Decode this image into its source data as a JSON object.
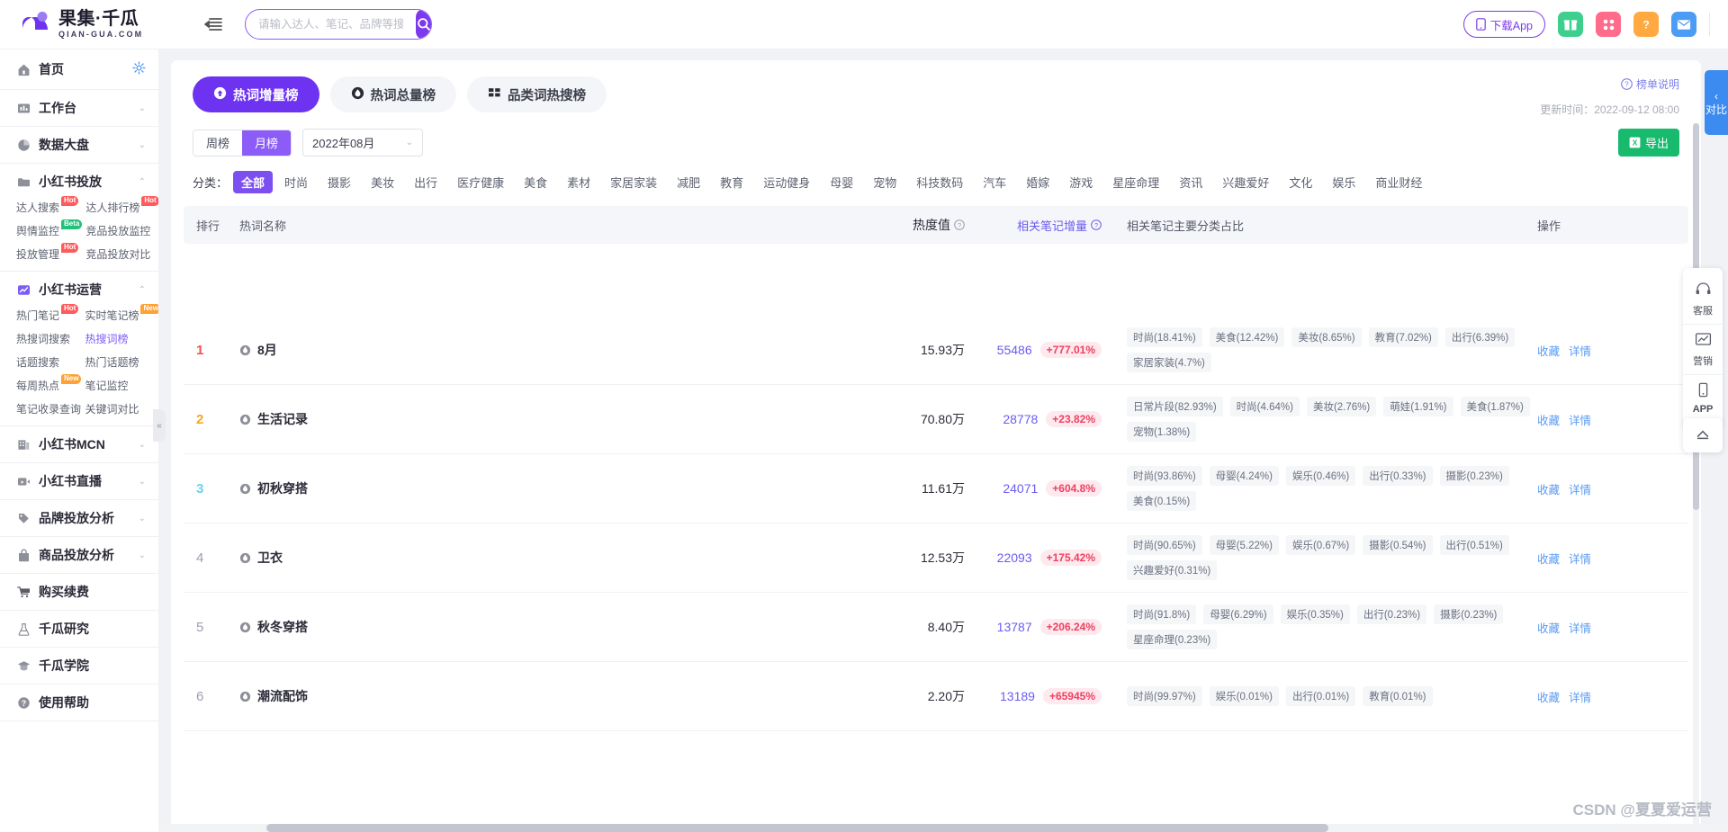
{
  "brand": {
    "name_cn": "果集·千瓜",
    "name_en": "QIAN-GUA.COM"
  },
  "search": {
    "placeholder": "请输入达人、笔记、品牌等搜索",
    "value": ""
  },
  "topbar": {
    "download_label": "下载App",
    "icons": [
      "collapse-icon",
      "search-icon",
      "gift-icon",
      "apps-icon",
      "help-icon",
      "mail-icon"
    ]
  },
  "sidebar": {
    "groups": [
      {
        "label": "首页",
        "icon": "home-icon",
        "caret": "",
        "gear": true,
        "subs": []
      },
      {
        "label": "工作台",
        "icon": "workbench-icon",
        "caret": "⌄",
        "subs": []
      },
      {
        "label": "数据大盘",
        "icon": "pie-chart-icon",
        "caret": "⌄",
        "subs": []
      },
      {
        "label": "小红书投放",
        "icon": "folder-icon",
        "caret": "⌃",
        "subs": [
          {
            "label": "达人搜索",
            "tag": "Hot",
            "tag_type": "hot"
          },
          {
            "label": "达人排行榜",
            "tag": "Hot",
            "tag_type": "hot"
          },
          {
            "label": "舆情监控",
            "tag": "Beta",
            "tag_type": "beta"
          },
          {
            "label": "竞品投放监控",
            "tag": "",
            "tag_type": ""
          },
          {
            "label": "投放管理",
            "tag": "Hot",
            "tag_type": "hot"
          },
          {
            "label": "竞品投放对比",
            "tag": "",
            "tag_type": ""
          }
        ]
      },
      {
        "label": "小红书运营",
        "icon": "chart-line-icon",
        "caret": "⌃",
        "subs": [
          {
            "label": "热门笔记",
            "tag": "Hot",
            "tag_type": "hot"
          },
          {
            "label": "实时笔记榜",
            "tag": "New",
            "tag_type": "new"
          },
          {
            "label": "热搜词搜索",
            "tag": "",
            "tag_type": ""
          },
          {
            "label": "热搜词榜",
            "tag": "",
            "tag_type": "",
            "active": true
          },
          {
            "label": "话题搜索",
            "tag": "",
            "tag_type": ""
          },
          {
            "label": "热门话题榜",
            "tag": "",
            "tag_type": ""
          },
          {
            "label": "每周热点",
            "tag": "New",
            "tag_type": "new"
          },
          {
            "label": "笔记监控",
            "tag": "",
            "tag_type": ""
          },
          {
            "label": "笔记收录查询",
            "tag": "",
            "tag_type": ""
          },
          {
            "label": "关键词对比",
            "tag": "",
            "tag_type": ""
          }
        ]
      },
      {
        "label": "小红书MCN",
        "icon": "building-icon",
        "caret": "⌄",
        "subs": []
      },
      {
        "label": "小红书直播",
        "icon": "video-icon",
        "caret": "⌄",
        "subs": []
      },
      {
        "label": "品牌投放分析",
        "icon": "tag-icon",
        "caret": "⌄",
        "subs": []
      },
      {
        "label": "商品投放分析",
        "icon": "bag-icon",
        "caret": "⌄",
        "subs": []
      },
      {
        "label": "购买续费",
        "icon": "cart-icon",
        "caret": "",
        "subs": []
      },
      {
        "label": "千瓜研究",
        "icon": "flask-icon",
        "caret": "",
        "subs": []
      },
      {
        "label": "千瓜学院",
        "icon": "graduation-icon",
        "caret": "",
        "subs": []
      },
      {
        "label": "使用帮助",
        "icon": "question-icon",
        "caret": "",
        "subs": []
      }
    ]
  },
  "tabs": [
    {
      "label": "热词增量榜",
      "icon": "arrow-up-circle-icon",
      "active": true
    },
    {
      "label": "热词总量榜",
      "icon": "droplet-circle-icon",
      "active": false
    },
    {
      "label": "品类词热搜榜",
      "icon": "grid-icon",
      "active": false
    }
  ],
  "header_info": {
    "rank_help": "榜单说明",
    "update_time": "更新时间：2022-09-12 08:00"
  },
  "filters": {
    "period": {
      "options": [
        "周榜",
        "月榜"
      ],
      "selected": "月榜"
    },
    "month": {
      "value": "2022年08月"
    },
    "export_label": "导出"
  },
  "categories": {
    "label": "分类：",
    "items": [
      "全部",
      "时尚",
      "摄影",
      "美妆",
      "出行",
      "医疗健康",
      "美食",
      "素材",
      "家居家装",
      "减肥",
      "教育",
      "运动健身",
      "母婴",
      "宠物",
      "科技数码",
      "汽车",
      "婚嫁",
      "游戏",
      "星座命理",
      "资讯",
      "兴趣爱好",
      "文化",
      "娱乐",
      "商业财经"
    ],
    "selected": "全部"
  },
  "table": {
    "columns": {
      "rank": "排行",
      "keyword": "热词名称",
      "heat": "热度值",
      "note_delta": "相关笔记增量",
      "category_share": "相关笔记主要分类占比",
      "ops": "操作"
    },
    "ops": {
      "favorite": "收藏",
      "detail": "详情"
    },
    "rows": [
      {
        "rank": "1",
        "keyword": "8月",
        "heat": "15.93万",
        "delta_num": "55486",
        "delta_pct": "+777.01%",
        "tags": [
          "时尚(18.41%)",
          "美食(12.42%)",
          "美妆(8.65%)",
          "教育(7.02%)",
          "出行(6.39%)",
          "家居家装(4.7%)"
        ]
      },
      {
        "rank": "2",
        "keyword": "生活记录",
        "heat": "70.80万",
        "delta_num": "28778",
        "delta_pct": "+23.82%",
        "tags": [
          "日常片段(82.93%)",
          "时尚(4.64%)",
          "美妆(2.76%)",
          "萌娃(1.91%)",
          "美食(1.87%)",
          "宠物(1.38%)"
        ]
      },
      {
        "rank": "3",
        "keyword": "初秋穿搭",
        "heat": "11.61万",
        "delta_num": "24071",
        "delta_pct": "+604.8%",
        "tags": [
          "时尚(93.86%)",
          "母婴(4.24%)",
          "娱乐(0.46%)",
          "出行(0.33%)",
          "摄影(0.23%)",
          "美食(0.15%)"
        ]
      },
      {
        "rank": "4",
        "keyword": "卫衣",
        "heat": "12.53万",
        "delta_num": "22093",
        "delta_pct": "+175.42%",
        "tags": [
          "时尚(90.65%)",
          "母婴(5.22%)",
          "娱乐(0.67%)",
          "摄影(0.54%)",
          "出行(0.51%)",
          "兴趣爱好(0.31%)"
        ]
      },
      {
        "rank": "5",
        "keyword": "秋冬穿搭",
        "heat": "8.40万",
        "delta_num": "13787",
        "delta_pct": "+206.24%",
        "tags": [
          "时尚(91.8%)",
          "母婴(6.29%)",
          "娱乐(0.35%)",
          "出行(0.23%)",
          "摄影(0.23%)",
          "星座命理(0.23%)"
        ]
      },
      {
        "rank": "6",
        "keyword": "潮流配饰",
        "heat": "2.20万",
        "delta_num": "13189",
        "delta_pct": "+65945%",
        "tags": [
          "时尚(99.97%)",
          "娱乐(0.01%)",
          "出行(0.01%)",
          "教育(0.01%)"
        ]
      }
    ]
  },
  "float_tools": [
    {
      "label": "客服",
      "icon": "headset-icon"
    },
    {
      "label": "营销",
      "icon": "marketing-chart-icon"
    },
    {
      "label": "APP",
      "icon": "phone-icon"
    }
  ],
  "side_compare": {
    "label": "对比",
    "icon": "chevron-left-icon"
  },
  "watermark": "CSDN @夏夏爱运营",
  "colors": {
    "primary": "#7c3aed",
    "tab_active": "#6d33f0",
    "export_green": "#18ba6e",
    "delta_red": "#ef4060",
    "link_blue": "#5b9bf5"
  }
}
